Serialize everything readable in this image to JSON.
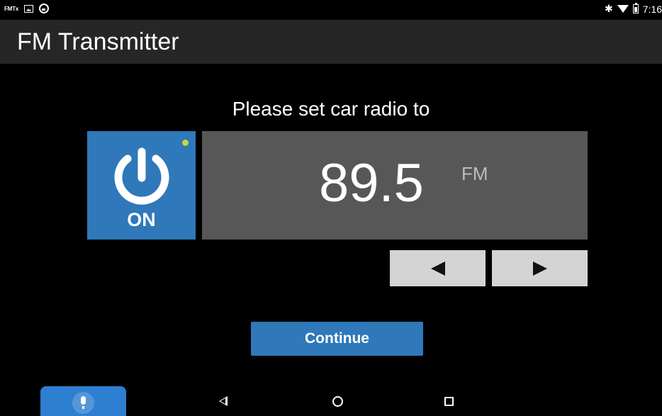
{
  "status_bar": {
    "notification_icons": [
      "fmtx-icon",
      "photo-icon",
      "steering-wheel-icon"
    ],
    "fmtx_label": "FMTx",
    "system_icons": [
      "bluetooth-icon",
      "wifi-icon",
      "battery-icon"
    ],
    "time": "7:16"
  },
  "app_bar": {
    "title": "FM Transmitter"
  },
  "main": {
    "prompt": "Please set car radio to",
    "power": {
      "label": "ON",
      "icon": "power-icon",
      "indicator_color": "#c8d83a"
    },
    "frequency": {
      "value": "89.5",
      "unit": "FM"
    },
    "tuning": {
      "prev_icon": "triangle-left-icon",
      "next_icon": "triangle-right-icon"
    },
    "continue_label": "Continue"
  },
  "nav_bar": {
    "icons": [
      "microphone-icon",
      "back-icon",
      "home-icon",
      "recents-icon"
    ]
  },
  "colors": {
    "accent": "#2f78b9",
    "mic_button": "#2e7fd1",
    "panel": "#575757",
    "app_bar": "#262626",
    "arrow_button": "#d4d4d4"
  }
}
